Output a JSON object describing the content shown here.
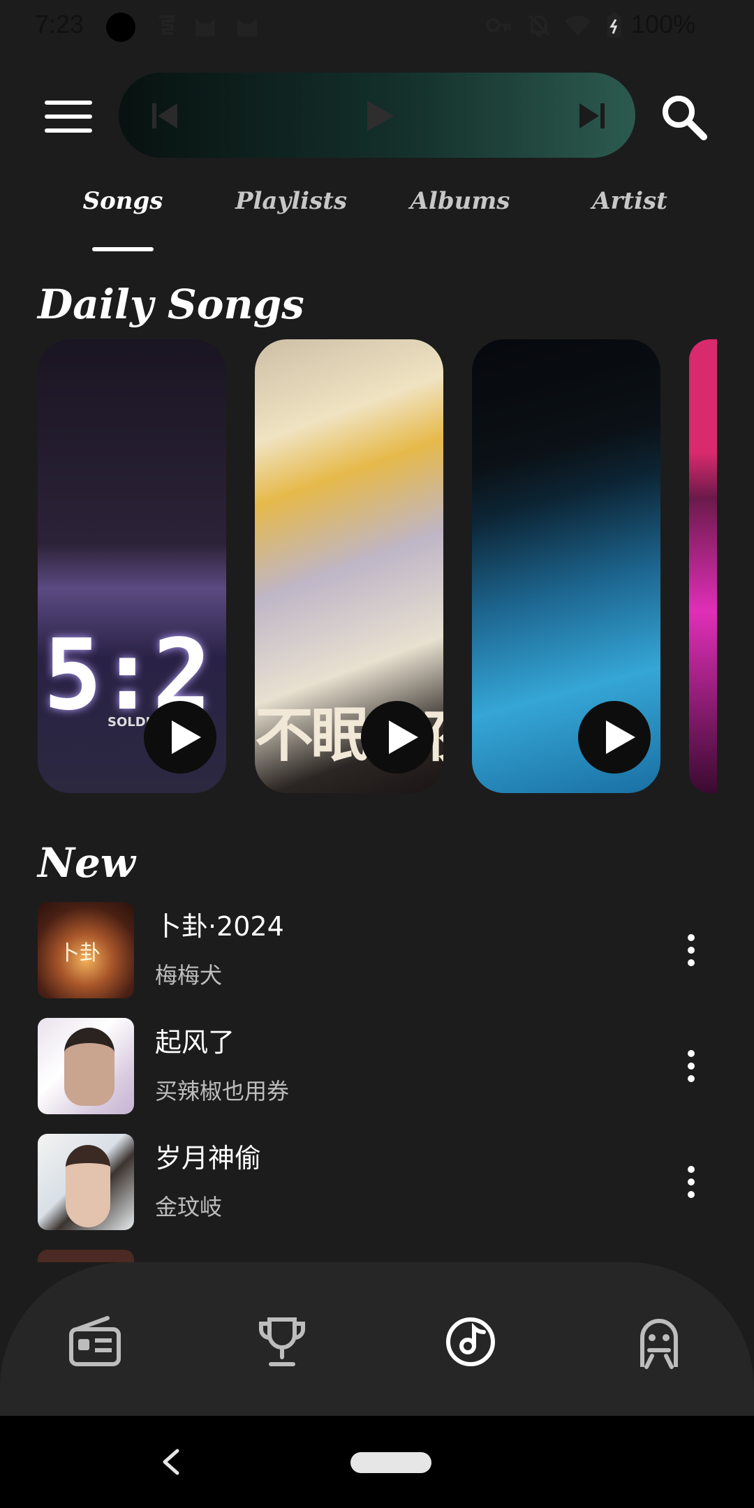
{
  "status_bar": {
    "time": "7:23",
    "battery": "100%"
  },
  "header": {
    "menu_icon": "hamburger-menu-icon",
    "mini_player": {
      "prev_icon": "skip-previous-icon",
      "play_icon": "play-icon",
      "next_icon": "skip-next-icon"
    },
    "search_icon": "search-icon"
  },
  "tabs": [
    {
      "label": "Songs",
      "active": true
    },
    {
      "label": "Playlists",
      "active": false
    },
    {
      "label": "Albums",
      "active": false
    },
    {
      "label": "Artist",
      "active": false
    }
  ],
  "daily_songs": {
    "title": "Daily Songs",
    "card1_digits": "5:2",
    "card1_label": "SOLDIE",
    "card2_banner": "不眠之夜"
  },
  "new_section": {
    "title": "New",
    "songs": [
      {
        "title": "卜卦·2024",
        "artist": "梅梅犬",
        "cover_text": "卜卦"
      },
      {
        "title": "起风了",
        "artist": "买辣椒也用券"
      },
      {
        "title": "岁月神偷",
        "artist": "金玟岐"
      }
    ]
  },
  "bottom_nav": [
    {
      "icon": "radio-icon"
    },
    {
      "icon": "trophy-icon"
    },
    {
      "icon": "music-disc-icon",
      "active": true
    },
    {
      "icon": "alien-profile-icon"
    }
  ],
  "colors": {
    "background": "#1c1c1c",
    "nav_background": "#262626",
    "player_gradient_end": "#2c5a4f"
  }
}
